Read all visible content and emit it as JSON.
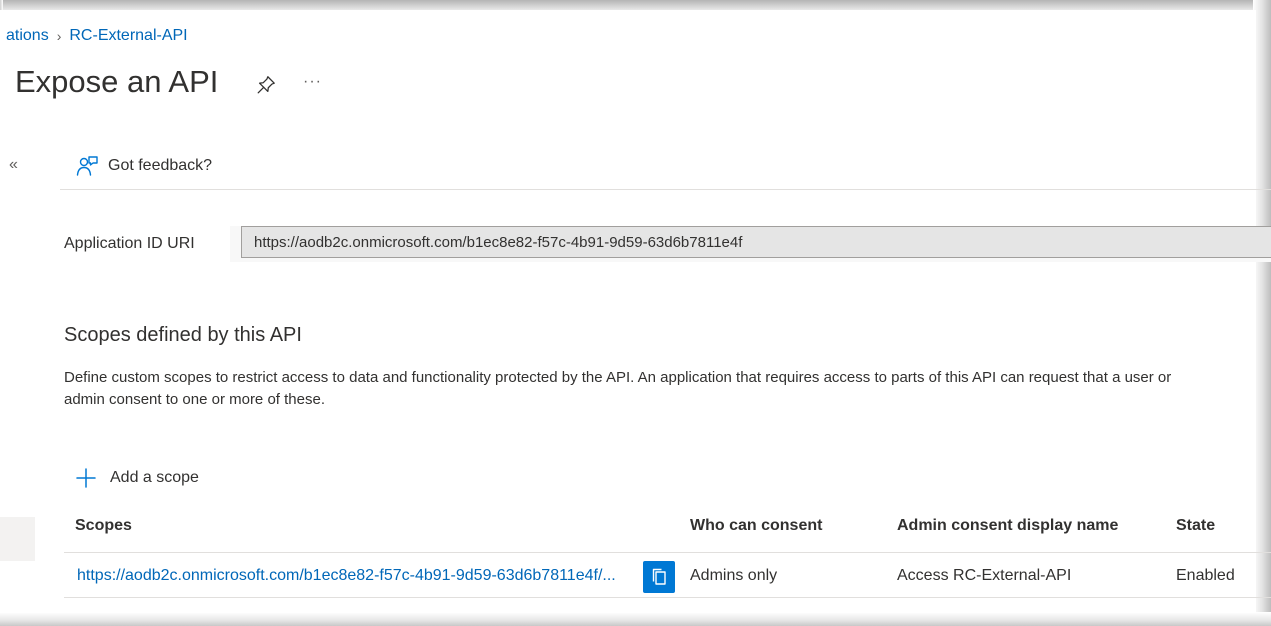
{
  "breadcrumb": {
    "parent": "ations",
    "current": "RC-External-API"
  },
  "page": {
    "title": "Expose an API",
    "more": "···",
    "collapse": "«"
  },
  "toolbar": {
    "feedback_label": "Got feedback?"
  },
  "app_id_uri": {
    "label": "Application ID URI",
    "value": "https://aodb2c.onmicrosoft.com/b1ec8e82-f57c-4b91-9d59-63d6b7811e4f"
  },
  "scopes_section": {
    "title": "Scopes defined by this API",
    "description": "Define custom scopes to restrict access to data and functionality protected by the API. An application that requires access to parts of this API can request that a user or admin consent to one or more of these.",
    "add_label": "Add a scope"
  },
  "table": {
    "headers": {
      "scopes": "Scopes",
      "who_can_consent": "Who can consent",
      "admin_display_name": "Admin consent display name",
      "state": "State"
    },
    "rows": [
      {
        "scope": "https://aodb2c.onmicrosoft.com/b1ec8e82-f57c-4b91-9d59-63d6b7811e4f/...",
        "who_can_consent": "Admins only",
        "admin_display_name": "Access RC-External-API",
        "state": "Enabled"
      }
    ]
  },
  "colors": {
    "accent": "#0078d4",
    "link": "#0067b8",
    "text": "#323130",
    "divider": "#e1dfdd"
  },
  "icons": {
    "pin": "pin-icon",
    "feedback": "feedback-icon",
    "add": "plus-icon",
    "copy": "copy-icon",
    "collapse": "double-chevron-left-icon"
  }
}
